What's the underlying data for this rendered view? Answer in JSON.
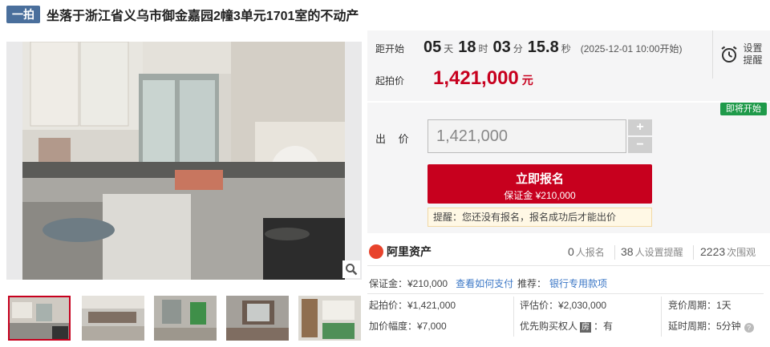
{
  "header": {
    "badge": "一拍",
    "title": "坐落于浙江省义乌市御金嘉园2幢3单元1701室的不动产"
  },
  "countdown": {
    "label": "距开始",
    "days": "05",
    "days_unit": "天",
    "hours": "18",
    "hours_unit": "时",
    "minutes": "03",
    "minutes_unit": "分",
    "seconds": "15.8",
    "seconds_unit": "秒",
    "start_note": "(2025-12-01 10:00开始)"
  },
  "start_price": {
    "label": "起拍价",
    "value": "1,421,000",
    "unit": "元"
  },
  "reminder": {
    "label": "设置提醒",
    "icon": "alarm-clock-icon"
  },
  "status_tag": "即将开始",
  "bid": {
    "label": "出 价",
    "value": "1,421,000",
    "plus": "+",
    "minus": "−"
  },
  "signup_button": {
    "main": "立即报名",
    "sub": "保证金 ¥210,000"
  },
  "hint": "提醒：您还没有报名，报名成功后才能出价",
  "stats": {
    "brand": "阿里资产",
    "signups": "0",
    "signups_label": "人报名",
    "reminders": "38",
    "reminders_label": "人设置提醒",
    "views": "2223",
    "views_label": "次围观"
  },
  "details": {
    "deposit": "保证金：¥210,000",
    "deposit_link": "查看如何支付",
    "recommend_label": "推荐：",
    "recommend_link": "银行专用款项",
    "start_price": "起拍价：¥1,421,000",
    "appraisal": "评估价：¥2,030,000",
    "cycle": "竞价周期：1天",
    "increment": "加价幅度：¥7,000",
    "priority_label": "优先购买权人",
    "priority_badge": "房",
    "priority_value": "：有",
    "delay": "延时周期：5分钟"
  },
  "colors": {
    "accent": "#c7001e",
    "badge": "#4a6f9c",
    "status": "#1f9a4a",
    "link": "#3b77c6"
  }
}
